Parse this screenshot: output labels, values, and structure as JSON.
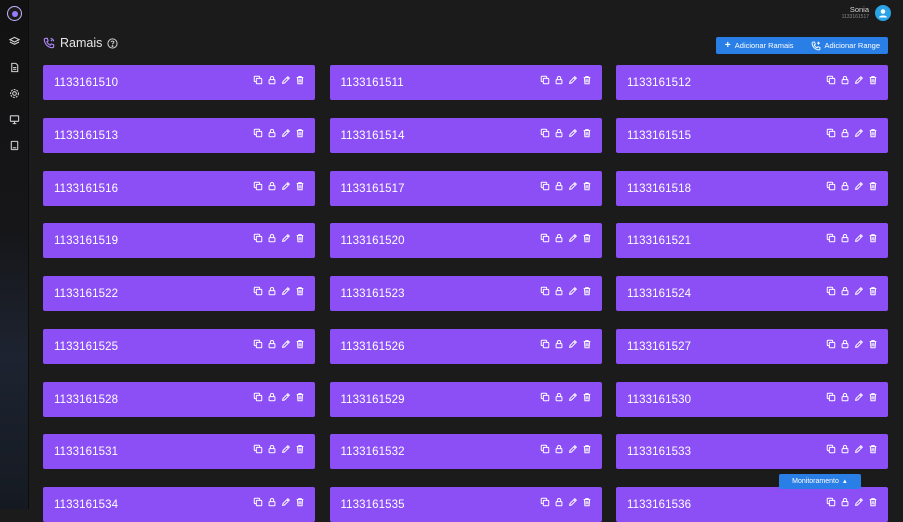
{
  "user": {
    "name": "Sonia",
    "extension": "1133161517"
  },
  "page": {
    "title": "Ramais"
  },
  "actions": {
    "add_ramais": "Adicionar Ramais",
    "add_range": "Adicionar Range"
  },
  "extensions": [
    "1133161510",
    "1133161511",
    "1133161512",
    "1133161513",
    "1133161514",
    "1133161515",
    "1133161516",
    "1133161517",
    "1133161518",
    "1133161519",
    "1133161520",
    "1133161521",
    "1133161522",
    "1133161523",
    "1133161524",
    "1133161525",
    "1133161526",
    "1133161527",
    "1133161528",
    "1133161529",
    "1133161530",
    "1133161531",
    "1133161532",
    "1133161533",
    "1133161534",
    "1133161535",
    "1133161536"
  ],
  "card_actions": [
    "copy-icon",
    "lock-icon",
    "edit-icon",
    "trash-icon"
  ],
  "sidebar_icons": [
    "layers-icon",
    "document-icon",
    "settings-icon",
    "monitor-icon",
    "book-icon"
  ],
  "monitor": {
    "label": "Monitoramento"
  },
  "colors": {
    "card": "#8b4ff5",
    "accent": "#2a7fe6",
    "background": "#1b1b1b"
  }
}
